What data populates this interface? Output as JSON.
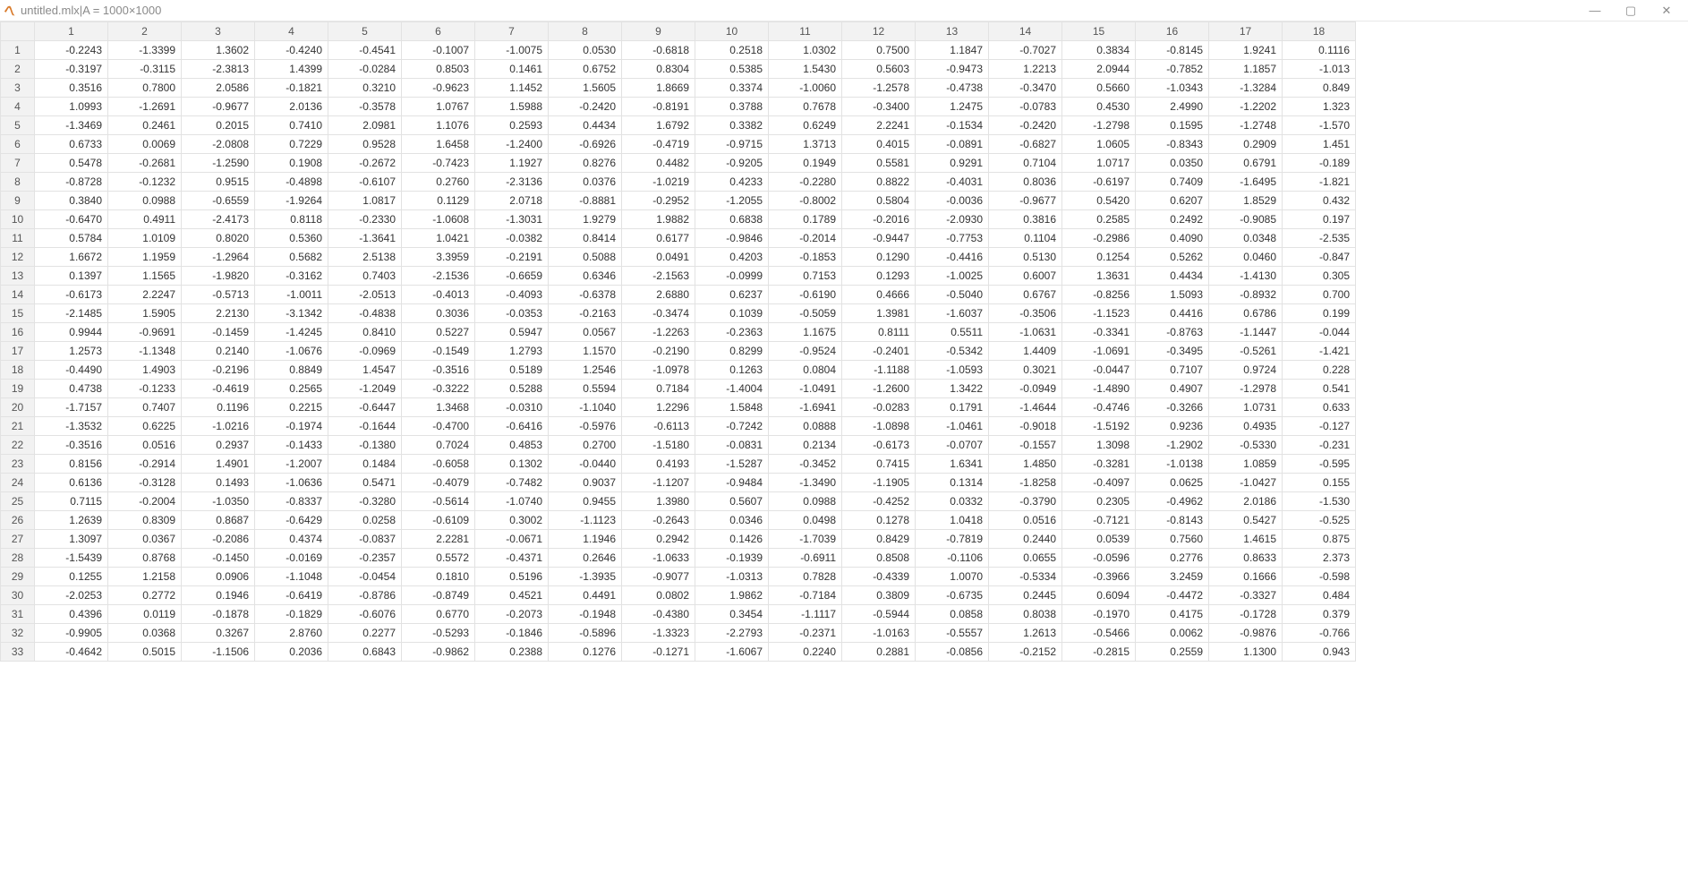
{
  "window": {
    "title_file": "untitled.mlx",
    "title_sep": " | ",
    "title_var": "A = 1000×1000",
    "minimize_glyph": "—",
    "maximize_glyph": "▢",
    "close_glyph": "✕"
  },
  "grid": {
    "col_headers": [
      "1",
      "2",
      "3",
      "4",
      "5",
      "6",
      "7",
      "8",
      "9",
      "10",
      "11",
      "12",
      "13",
      "14",
      "15",
      "16",
      "17",
      "18"
    ],
    "row_headers": [
      "1",
      "2",
      "3",
      "4",
      "5",
      "6",
      "7",
      "8",
      "9",
      "10",
      "11",
      "12",
      "13",
      "14",
      "15",
      "16",
      "17",
      "18",
      "19",
      "20",
      "21",
      "22",
      "23",
      "24",
      "25",
      "26",
      "27",
      "28",
      "29",
      "30",
      "31",
      "32",
      "33"
    ],
    "cells": [
      [
        "-0.2243",
        "-1.3399",
        "1.3602",
        "-0.4240",
        "-0.4541",
        "-0.1007",
        "-1.0075",
        "0.0530",
        "-0.6818",
        "0.2518",
        "1.0302",
        "0.7500",
        "1.1847",
        "-0.7027",
        "0.3834",
        "-0.8145",
        "1.9241",
        "0.1116"
      ],
      [
        "-0.3197",
        "-0.3115",
        "-2.3813",
        "1.4399",
        "-0.0284",
        "0.8503",
        "0.1461",
        "0.6752",
        "0.8304",
        "0.5385",
        "1.5430",
        "0.5603",
        "-0.9473",
        "1.2213",
        "2.0944",
        "-0.7852",
        "1.1857",
        "-1.013"
      ],
      [
        "0.3516",
        "0.7800",
        "2.0586",
        "-0.1821",
        "0.3210",
        "-0.9623",
        "1.1452",
        "1.5605",
        "1.8669",
        "0.3374",
        "-1.0060",
        "-1.2578",
        "-0.4738",
        "-0.3470",
        "0.5660",
        "-1.0343",
        "-1.3284",
        "0.849"
      ],
      [
        "1.0993",
        "-1.2691",
        "-0.9677",
        "2.0136",
        "-0.3578",
        "1.0767",
        "1.5988",
        "-0.2420",
        "-0.8191",
        "0.3788",
        "0.7678",
        "-0.3400",
        "1.2475",
        "-0.0783",
        "0.4530",
        "2.4990",
        "-1.2202",
        "1.323"
      ],
      [
        "-1.3469",
        "0.2461",
        "0.2015",
        "0.7410",
        "2.0981",
        "1.1076",
        "0.2593",
        "0.4434",
        "1.6792",
        "0.3382",
        "0.6249",
        "2.2241",
        "-0.1534",
        "-0.2420",
        "-1.2798",
        "0.1595",
        "-1.2748",
        "-1.570"
      ],
      [
        "0.6733",
        "0.0069",
        "-2.0808",
        "0.7229",
        "0.9528",
        "1.6458",
        "-1.2400",
        "-0.6926",
        "-0.4719",
        "-0.9715",
        "1.3713",
        "0.4015",
        "-0.0891",
        "-0.6827",
        "1.0605",
        "-0.8343",
        "0.2909",
        "1.451"
      ],
      [
        "0.5478",
        "-0.2681",
        "-1.2590",
        "0.1908",
        "-0.2672",
        "-0.7423",
        "1.1927",
        "0.8276",
        "0.4482",
        "-0.9205",
        "0.1949",
        "0.5581",
        "0.9291",
        "0.7104",
        "1.0717",
        "0.0350",
        "0.6791",
        "-0.189"
      ],
      [
        "-0.8728",
        "-0.1232",
        "0.9515",
        "-0.4898",
        "-0.6107",
        "0.2760",
        "-2.3136",
        "0.0376",
        "-1.0219",
        "0.4233",
        "-0.2280",
        "0.8822",
        "-0.4031",
        "0.8036",
        "-0.6197",
        "0.7409",
        "-1.6495",
        "-1.821"
      ],
      [
        "0.3840",
        "0.0988",
        "-0.6559",
        "-1.9264",
        "1.0817",
        "0.1129",
        "2.0718",
        "-0.8881",
        "-0.2952",
        "-1.2055",
        "-0.8002",
        "0.5804",
        "-0.0036",
        "-0.9677",
        "0.5420",
        "0.6207",
        "1.8529",
        "0.432"
      ],
      [
        "-0.6470",
        "0.4911",
        "-2.4173",
        "0.8118",
        "-0.2330",
        "-1.0608",
        "-1.3031",
        "1.9279",
        "1.9882",
        "0.6838",
        "0.1789",
        "-0.2016",
        "-2.0930",
        "0.3816",
        "0.2585",
        "0.2492",
        "-0.9085",
        "0.197"
      ],
      [
        "0.5784",
        "1.0109",
        "0.8020",
        "0.5360",
        "-1.3641",
        "1.0421",
        "-0.0382",
        "0.8414",
        "0.6177",
        "-0.9846",
        "-0.2014",
        "-0.9447",
        "-0.7753",
        "0.1104",
        "-0.2986",
        "0.4090",
        "0.0348",
        "-2.535"
      ],
      [
        "1.6672",
        "1.1959",
        "-1.2964",
        "0.5682",
        "2.5138",
        "3.3959",
        "-0.2191",
        "0.5088",
        "0.0491",
        "0.4203",
        "-0.1853",
        "0.1290",
        "-0.4416",
        "0.5130",
        "0.1254",
        "0.5262",
        "0.0460",
        "-0.847"
      ],
      [
        "0.1397",
        "1.1565",
        "-1.9820",
        "-0.3162",
        "0.7403",
        "-2.1536",
        "-0.6659",
        "0.6346",
        "-2.1563",
        "-0.0999",
        "0.7153",
        "0.1293",
        "-1.0025",
        "0.6007",
        "1.3631",
        "0.4434",
        "-1.4130",
        "0.305"
      ],
      [
        "-0.6173",
        "2.2247",
        "-0.5713",
        "-1.0011",
        "-2.0513",
        "-0.4013",
        "-0.4093",
        "-0.6378",
        "2.6880",
        "0.6237",
        "-0.6190",
        "0.4666",
        "-0.5040",
        "0.6767",
        "-0.8256",
        "1.5093",
        "-0.8932",
        "0.700"
      ],
      [
        "-2.1485",
        "1.5905",
        "2.2130",
        "-3.1342",
        "-0.4838",
        "0.3036",
        "-0.0353",
        "-0.2163",
        "-0.3474",
        "0.1039",
        "-0.5059",
        "1.3981",
        "-1.6037",
        "-0.3506",
        "-1.1523",
        "0.4416",
        "0.6786",
        "0.199"
      ],
      [
        "0.9944",
        "-0.9691",
        "-0.1459",
        "-1.4245",
        "0.8410",
        "0.5227",
        "0.5947",
        "0.0567",
        "-1.2263",
        "-0.2363",
        "1.1675",
        "0.8111",
        "0.5511",
        "-1.0631",
        "-0.3341",
        "-0.8763",
        "-1.1447",
        "-0.044"
      ],
      [
        "1.2573",
        "-1.1348",
        "0.2140",
        "-1.0676",
        "-0.0969",
        "-0.1549",
        "1.2793",
        "1.1570",
        "-0.2190",
        "0.8299",
        "-0.9524",
        "-0.2401",
        "-0.5342",
        "1.4409",
        "-1.0691",
        "-0.3495",
        "-0.5261",
        "-1.421"
      ],
      [
        "-0.4490",
        "1.4903",
        "-0.2196",
        "0.8849",
        "1.4547",
        "-0.3516",
        "0.5189",
        "1.2546",
        "-1.0978",
        "0.1263",
        "0.0804",
        "-1.1188",
        "-1.0593",
        "0.3021",
        "-0.0447",
        "0.7107",
        "0.9724",
        "0.228"
      ],
      [
        "0.4738",
        "-0.1233",
        "-0.4619",
        "0.2565",
        "-1.2049",
        "-0.3222",
        "0.5288",
        "0.5594",
        "0.7184",
        "-1.4004",
        "-1.0491",
        "-1.2600",
        "1.3422",
        "-0.0949",
        "-1.4890",
        "0.4907",
        "-1.2978",
        "0.541"
      ],
      [
        "-1.7157",
        "0.7407",
        "0.1196",
        "0.2215",
        "-0.6447",
        "1.3468",
        "-0.0310",
        "-1.1040",
        "1.2296",
        "1.5848",
        "-1.6941",
        "-0.0283",
        "0.1791",
        "-1.4644",
        "-0.4746",
        "-0.3266",
        "1.0731",
        "0.633"
      ],
      [
        "-1.3532",
        "0.6225",
        "-1.0216",
        "-0.1974",
        "-0.1644",
        "-0.4700",
        "-0.6416",
        "-0.5976",
        "-0.6113",
        "-0.7242",
        "0.0888",
        "-1.0898",
        "-1.0461",
        "-0.9018",
        "-1.5192",
        "0.9236",
        "0.4935",
        "-0.127"
      ],
      [
        "-0.3516",
        "0.0516",
        "0.2937",
        "-0.1433",
        "-0.1380",
        "0.7024",
        "0.4853",
        "0.2700",
        "-1.5180",
        "-0.0831",
        "0.2134",
        "-0.6173",
        "-0.0707",
        "-0.1557",
        "1.3098",
        "-1.2902",
        "-0.5330",
        "-0.231"
      ],
      [
        "0.8156",
        "-0.2914",
        "1.4901",
        "-1.2007",
        "0.1484",
        "-0.6058",
        "0.1302",
        "-0.0440",
        "0.4193",
        "-1.5287",
        "-0.3452",
        "0.7415",
        "1.6341",
        "1.4850",
        "-0.3281",
        "-1.0138",
        "1.0859",
        "-0.595"
      ],
      [
        "0.6136",
        "-0.3128",
        "0.1493",
        "-1.0636",
        "0.5471",
        "-0.4079",
        "-0.7482",
        "0.9037",
        "-1.1207",
        "-0.9484",
        "-1.3490",
        "-1.1905",
        "0.1314",
        "-1.8258",
        "-0.4097",
        "0.0625",
        "-1.0427",
        "0.155"
      ],
      [
        "0.7115",
        "-0.2004",
        "-1.0350",
        "-0.8337",
        "-0.3280",
        "-0.5614",
        "-1.0740",
        "0.9455",
        "1.3980",
        "0.5607",
        "0.0988",
        "-0.4252",
        "0.0332",
        "-0.3790",
        "0.2305",
        "-0.4962",
        "2.0186",
        "-1.530"
      ],
      [
        "1.2639",
        "0.8309",
        "0.8687",
        "-0.6429",
        "0.0258",
        "-0.6109",
        "0.3002",
        "-1.1123",
        "-0.2643",
        "0.0346",
        "0.0498",
        "0.1278",
        "1.0418",
        "0.0516",
        "-0.7121",
        "-0.8143",
        "0.5427",
        "-0.525"
      ],
      [
        "1.3097",
        "0.0367",
        "-0.2086",
        "0.4374",
        "-0.0837",
        "2.2281",
        "-0.0671",
        "1.1946",
        "0.2942",
        "0.1426",
        "-1.7039",
        "0.8429",
        "-0.7819",
        "0.2440",
        "0.0539",
        "0.7560",
        "1.4615",
        "0.875"
      ],
      [
        "-1.5439",
        "0.8768",
        "-0.1450",
        "-0.0169",
        "-0.2357",
        "0.5572",
        "-0.4371",
        "0.2646",
        "-1.0633",
        "-0.1939",
        "-0.6911",
        "0.8508",
        "-0.1106",
        "0.0655",
        "-0.0596",
        "0.2776",
        "0.8633",
        "2.373"
      ],
      [
        "0.1255",
        "1.2158",
        "0.0906",
        "-1.1048",
        "-0.0454",
        "0.1810",
        "0.5196",
        "-1.3935",
        "-0.9077",
        "-1.0313",
        "0.7828",
        "-0.4339",
        "1.0070",
        "-0.5334",
        "-0.3966",
        "3.2459",
        "0.1666",
        "-0.598"
      ],
      [
        "-2.0253",
        "0.2772",
        "0.1946",
        "-0.6419",
        "-0.8786",
        "-0.8749",
        "0.4521",
        "0.4491",
        "0.0802",
        "1.9862",
        "-0.7184",
        "0.3809",
        "-0.6735",
        "0.2445",
        "0.6094",
        "-0.4472",
        "-0.3327",
        "0.484"
      ],
      [
        "0.4396",
        "0.0119",
        "-0.1878",
        "-0.1829",
        "-0.6076",
        "0.6770",
        "-0.2073",
        "-0.1948",
        "-0.4380",
        "0.3454",
        "-1.1117",
        "-0.5944",
        "0.0858",
        "0.8038",
        "-0.1970",
        "0.4175",
        "-0.1728",
        "0.379"
      ],
      [
        "-0.9905",
        "0.0368",
        "0.3267",
        "2.8760",
        "0.2277",
        "-0.5293",
        "-0.1846",
        "-0.5896",
        "-1.3323",
        "-2.2793",
        "-0.2371",
        "-1.0163",
        "-0.5557",
        "1.2613",
        "-0.5466",
        "0.0062",
        "-0.9876",
        "-0.766"
      ],
      [
        "-0.4642",
        "0.5015",
        "-1.1506",
        "0.2036",
        "0.6843",
        "-0.9862",
        "0.2388",
        "0.1276",
        "-0.1271",
        "-1.6067",
        "0.2240",
        "0.2881",
        "-0.0856",
        "-0.2152",
        "-0.2815",
        "0.2559",
        "1.1300",
        "0.943"
      ]
    ]
  }
}
